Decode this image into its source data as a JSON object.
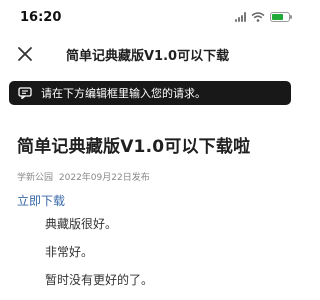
{
  "status_bar": {
    "time": "16:20",
    "icons": [
      "signal-icon",
      "wifi-icon",
      "battery-icon"
    ],
    "battery_level": 0.6
  },
  "nav": {
    "close_icon": "close-icon",
    "title": "简单记典藏版V1.0可以下载"
  },
  "prompt": {
    "icon": "chat-icon",
    "text": "请在下方编辑框里输入您的请求。"
  },
  "article": {
    "title": "简单记典藏版V1.0可以下载啦",
    "author": "学新公园",
    "date": "2022年09月22日发布",
    "download_link": "立即下载",
    "paragraphs": [
      "典藏版很好。",
      "非常好。",
      "暂时没有更好的了。"
    ]
  },
  "colors": {
    "banner_bg": "#181818",
    "link": "#3a6aa8",
    "battery": "#1faa3a"
  }
}
